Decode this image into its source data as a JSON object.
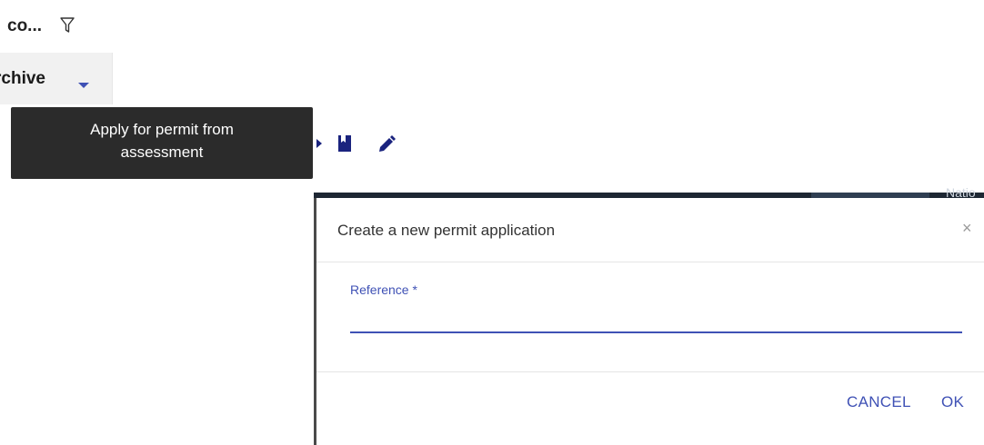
{
  "column_header": {
    "label": "co...",
    "filter_icon": "filter-icon"
  },
  "archive": {
    "label": "rchive",
    "caret_icon": "chevron-down-icon",
    "accent_color": "#3f51b5"
  },
  "row_actions": {
    "icons": [
      "play-icon",
      "book-icon",
      "edit-icon"
    ],
    "icon_color": "#1a237e"
  },
  "tooltip": {
    "line1": "Apply for permit from",
    "line2": "assessment"
  },
  "background": {
    "text": "Natio"
  },
  "dialog": {
    "title": "Create a new permit application",
    "close_icon": "×",
    "field_label": "Reference *",
    "field_value": "",
    "cancel_label": "CANCEL",
    "ok_label": "OK"
  }
}
